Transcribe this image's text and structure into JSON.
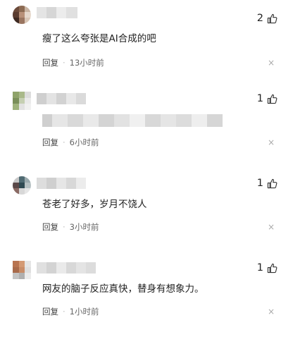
{
  "comments": [
    {
      "text": "瘦了这么夸张是AI合成的吧",
      "likes": "2",
      "reply_label": "回复",
      "separator": "·",
      "time": "13小时前",
      "close_glyph": "×"
    },
    {
      "text": "",
      "likes": "1",
      "reply_label": "回复",
      "separator": "·",
      "time": "6小时前",
      "close_glyph": "×"
    },
    {
      "text": "苍老了好多，岁月不饶人",
      "likes": "1",
      "reply_label": "回复",
      "separator": "·",
      "time": "3小时前",
      "close_glyph": "×"
    },
    {
      "text": "网友的脑子反应真快，替身有想象力。",
      "likes": "1",
      "reply_label": "回复",
      "separator": "·",
      "time": "1小时前",
      "close_glyph": "×"
    }
  ]
}
